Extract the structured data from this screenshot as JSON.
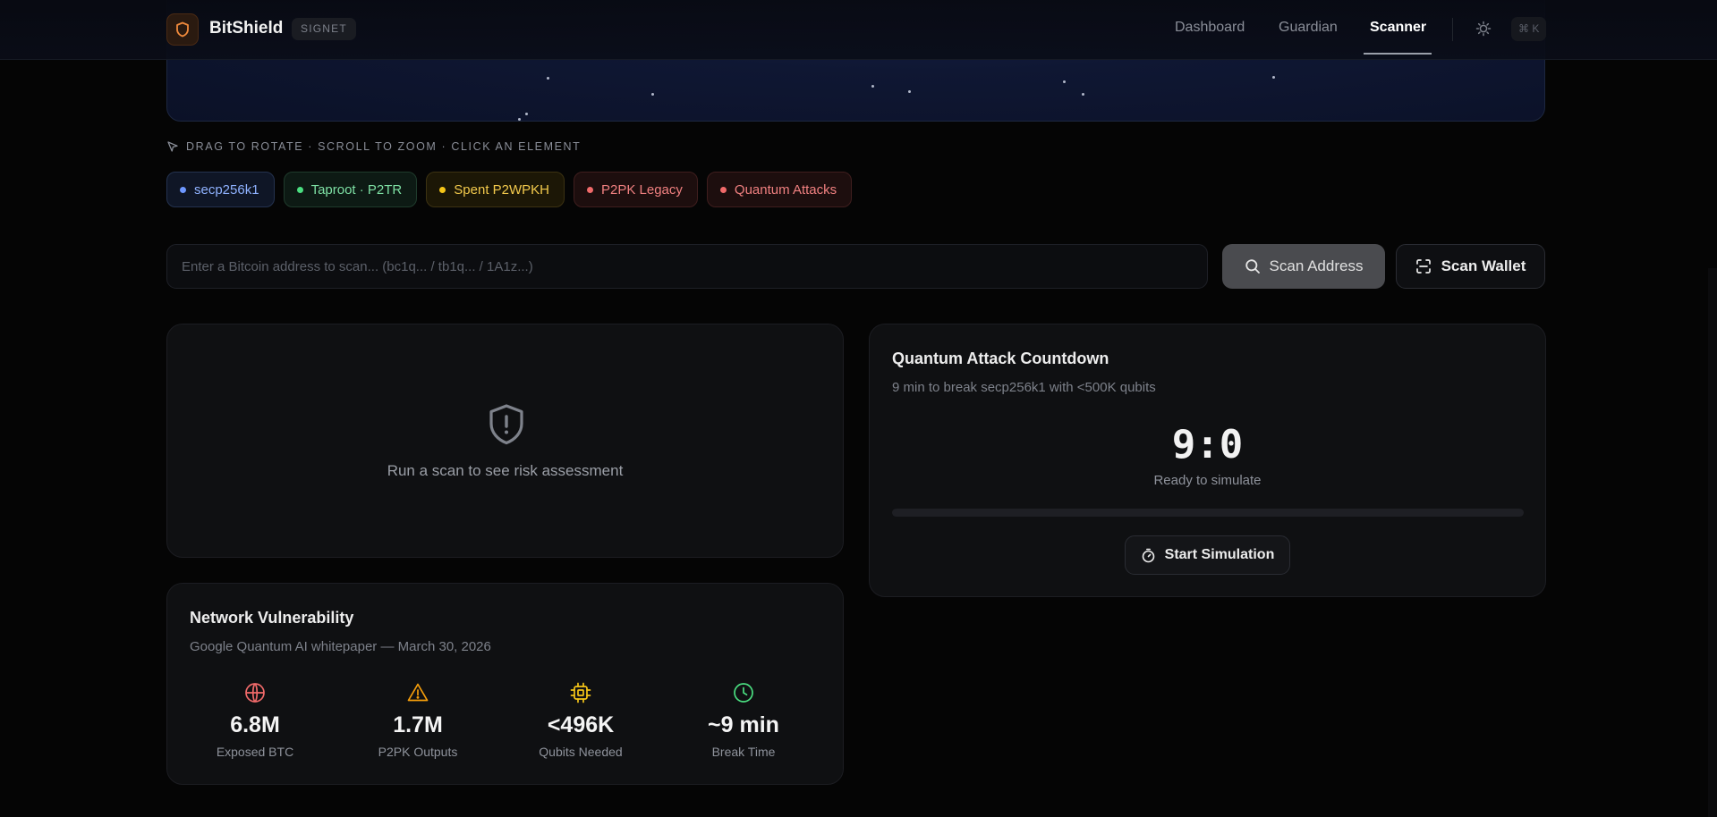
{
  "header": {
    "brand": "BitShield",
    "network_badge": "SIGNET",
    "nav": [
      {
        "label": "Dashboard",
        "active": false
      },
      {
        "label": "Guardian",
        "active": false
      },
      {
        "label": "Scanner",
        "active": true
      }
    ],
    "shortcut": "⌘ K",
    "icons": {
      "logo": "shield-icon",
      "theme": "sun-icon"
    }
  },
  "viewer": {
    "hint": "DRAG TO ROTATE · SCROLL TO ZOOM · CLICK AN ELEMENT",
    "chips": [
      {
        "label": "secp256k1",
        "color": "#6d97ff"
      },
      {
        "label": "Taproot · P2TR",
        "color": "#4ade80"
      },
      {
        "label": "Spent P2WPKH",
        "color": "#f5c518"
      },
      {
        "label": "P2PK Legacy",
        "color": "#f06a6a"
      },
      {
        "label": "Quantum Attacks",
        "color": "#f06a6a"
      }
    ]
  },
  "search": {
    "placeholder": "Enter a Bitcoin address to scan... (bc1q... / tb1q... / 1A1z...)",
    "value": "",
    "scan_address_label": "Scan Address",
    "scan_wallet_label": "Scan Wallet"
  },
  "risk": {
    "empty_text": "Run a scan to see risk assessment"
  },
  "countdown": {
    "title": "Quantum Attack Countdown",
    "subtitle": "9 min to break secp256k1 with <500K qubits",
    "timer": "9:0",
    "status": "Ready to simulate",
    "progress": 0,
    "button_label": "Start Simulation"
  },
  "network": {
    "title": "Network Vulnerability",
    "subtitle": "Google Quantum AI whitepaper — March 30, 2026",
    "stats": [
      {
        "value": "6.8M",
        "label": "Exposed BTC",
        "icon": "globe-icon",
        "color": "#f06a6a"
      },
      {
        "value": "1.7M",
        "label": "P2PK Outputs",
        "icon": "warning-icon",
        "color": "#f59e0b"
      },
      {
        "value": "<496K",
        "label": "Qubits Needed",
        "icon": "chip-icon",
        "color": "#f5c518"
      },
      {
        "value": "~9 min",
        "label": "Break Time",
        "icon": "clock-icon",
        "color": "#4ade80"
      }
    ]
  }
}
